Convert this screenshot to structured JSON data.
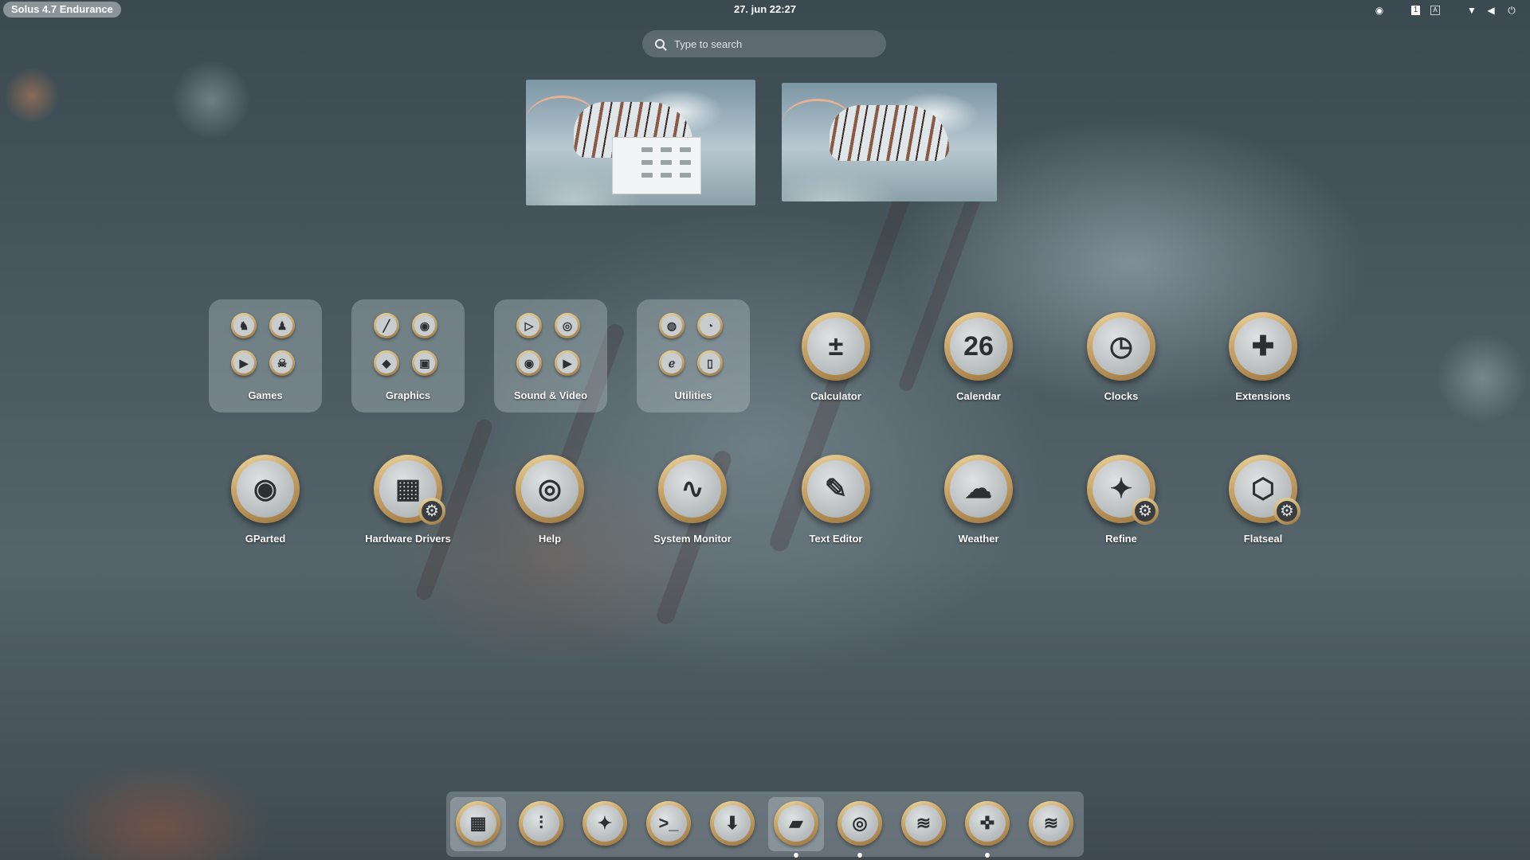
{
  "topbar": {
    "os_label": "Solus 4.7 Endurance",
    "clock": "27. jun  22:27",
    "tray_icons": [
      "steam-icon",
      "notification-icon",
      "keyboard-icon",
      "wifi-icon",
      "volume-icon",
      "power-icon"
    ]
  },
  "search": {
    "placeholder": "Type to search"
  },
  "workspaces": [
    {
      "name": "workspace-1"
    },
    {
      "name": "workspace-2"
    }
  ],
  "folders": [
    {
      "label": "Games",
      "icons": [
        "games-a-icon",
        "games-b-icon",
        "games-c-icon",
        "games-d-icon"
      ]
    },
    {
      "label": "Graphics",
      "icons": [
        "pen-icon",
        "eye-icon",
        "draw-icon",
        "screenshot-icon"
      ]
    },
    {
      "label": "Sound & Video",
      "icons": [
        "player-icon",
        "recorder-icon",
        "camera-icon",
        "play-icon"
      ]
    },
    {
      "label": "Utilities",
      "icons": [
        "chat-icon",
        "disk-usage-icon",
        "edit-icon",
        "mouse-icon"
      ]
    }
  ],
  "apps_row1": [
    {
      "label": "Calculator",
      "glyph": "±",
      "icon": "calculator-icon"
    },
    {
      "label": "Calendar",
      "glyph": "26",
      "icon": "calendar-icon"
    },
    {
      "label": "Clocks",
      "glyph": "◷",
      "icon": "clock-icon"
    },
    {
      "label": "Extensions",
      "glyph": "✚",
      "icon": "puzzle-icon"
    }
  ],
  "apps_row2": [
    {
      "label": "GParted",
      "glyph": "◉",
      "icon": "gparted-icon"
    },
    {
      "label": "Hardware Drivers",
      "glyph": "▦",
      "icon": "hardware-icon",
      "gear": true
    },
    {
      "label": "Help",
      "glyph": "◎",
      "icon": "lifebuoy-icon"
    },
    {
      "label": "System Monitor",
      "glyph": "∿",
      "icon": "pulse-icon"
    },
    {
      "label": "Text Editor",
      "glyph": "✎",
      "icon": "pencil-icon"
    },
    {
      "label": "Weather",
      "glyph": "☁",
      "icon": "weather-icon"
    },
    {
      "label": "Refine",
      "glyph": "✦",
      "icon": "wand-icon",
      "gear": true
    },
    {
      "label": "Flatseal",
      "glyph": "⬡",
      "icon": "flatseal-icon",
      "gear": true
    }
  ],
  "dock": [
    {
      "name": "app-grid-icon",
      "glyph": "▦",
      "active": true
    },
    {
      "name": "mixer-icon",
      "glyph": "⫶"
    },
    {
      "name": "wand-settings-icon",
      "glyph": "✦"
    },
    {
      "name": "terminal-icon",
      "glyph": ">_"
    },
    {
      "name": "software-icon",
      "glyph": "⬇"
    },
    {
      "name": "files-icon",
      "glyph": "▰",
      "active": true,
      "running": true
    },
    {
      "name": "chrome-icon",
      "glyph": "◎",
      "running": true
    },
    {
      "name": "spotify-icon",
      "glyph": "≋"
    },
    {
      "name": "gamepad-icon",
      "glyph": "✜",
      "running": true
    },
    {
      "name": "layers-icon",
      "glyph": "≋"
    }
  ],
  "colors": {
    "accent_gold": "#c9a468",
    "panel_bg": "#96a2a8"
  }
}
